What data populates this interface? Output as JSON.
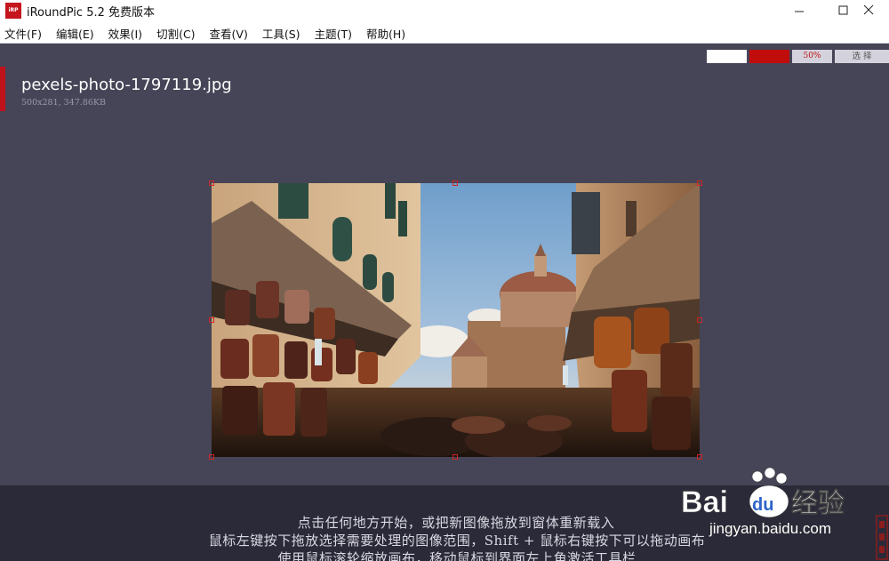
{
  "window": {
    "app_logo_text": "iRP",
    "title": "iRoundPic 5.2 免费版本"
  },
  "menu": {
    "items": [
      "文件(F)",
      "编辑(E)",
      "效果(I)",
      "切割(C)",
      "查看(V)",
      "工具(S)",
      "主题(T)",
      "帮助(H)"
    ]
  },
  "toolbar": {
    "zoom": "50%",
    "select_label": "选 择",
    "swatch_colors": [
      "#ffffff",
      "#c10c0c"
    ]
  },
  "file": {
    "name": "pexels-photo-1797119.jpg",
    "info": "500x281, 347.86KB"
  },
  "hints": {
    "line1": "点击任何地方开始，或把新图像拖放到窗体重新载入",
    "line2": "鼠标左键按下拖放选择需要处理的图像范围，Shift + 鼠标右键按下可以拖动画布",
    "line3": "使用鼠标滚轮缩放画布，移动鼠标到界面左上角激活工具栏"
  },
  "watermark": {
    "logo_text_left": "Bai",
    "logo_text_du": "du",
    "logo_text_right": "经验",
    "url": "jingyan.baidu.com"
  },
  "colors": {
    "accent": "#c0121a",
    "workspace_bg": "#464557",
    "footer_bg": "#2b2a39"
  }
}
